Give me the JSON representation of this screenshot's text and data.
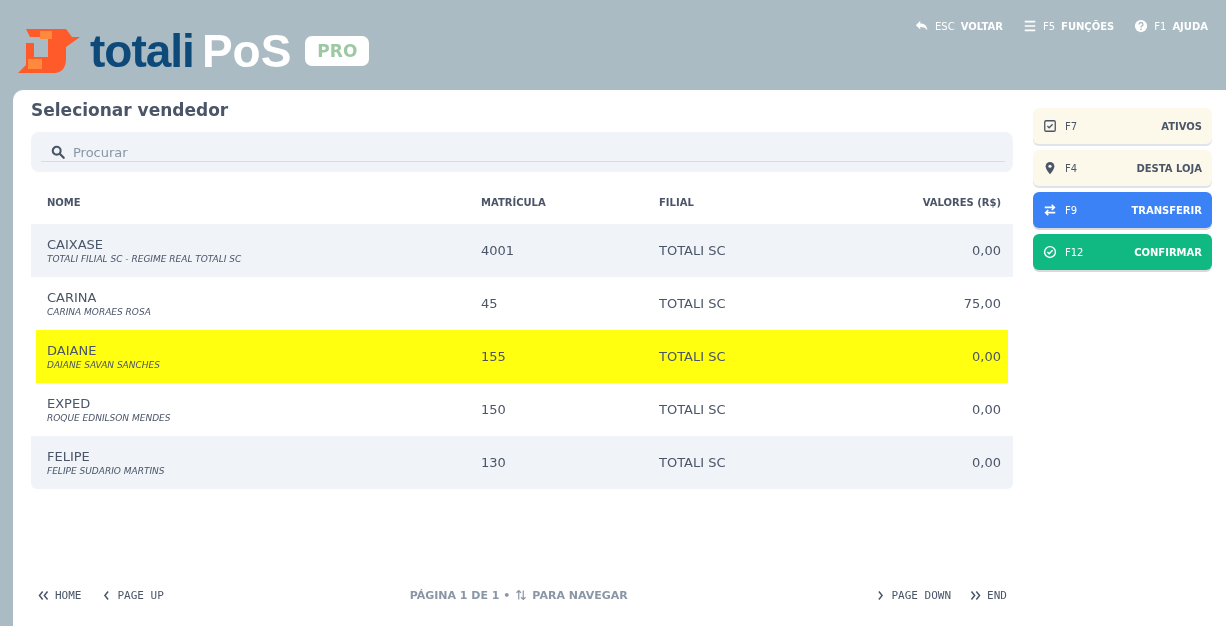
{
  "logo": {
    "brand": "totali",
    "product": "PoS",
    "badge": "PRO"
  },
  "top_actions": [
    {
      "kind": "back",
      "key": "ESC",
      "label": "VOLTAR"
    },
    {
      "kind": "menu",
      "key": "F5",
      "label": "FUNÇÕES"
    },
    {
      "kind": "help",
      "key": "F1",
      "label": "AJUDA"
    }
  ],
  "title": "Selecionar vendedor",
  "search": {
    "placeholder": "Procurar"
  },
  "table": {
    "columns": [
      "NOME",
      "MATRÍCULA",
      "FILIAL",
      "VALORES (R$)"
    ],
    "rows": [
      {
        "name": "CAIXASE",
        "subtitle": "TOTALI FILIAL SC - REGIME REAL TOTALI SC",
        "matricula": "4001",
        "filial": "TOTALI SC",
        "valor": "0,00",
        "selected": false
      },
      {
        "name": "CARINA",
        "subtitle": "CARINA MORAES ROSA",
        "matricula": "45",
        "filial": "TOTALI SC",
        "valor": "75,00",
        "selected": false
      },
      {
        "name": "DAIANE",
        "subtitle": "DAIANE SAVAN SANCHES",
        "matricula": "155",
        "filial": "TOTALI SC",
        "valor": "0,00",
        "selected": true
      },
      {
        "name": "EXPED",
        "subtitle": "ROQUE EDNILSON MENDES",
        "matricula": "150",
        "filial": "TOTALI SC",
        "valor": "0,00",
        "selected": false
      },
      {
        "name": "FELIPE",
        "subtitle": "FELIPE SUDARIO MARTINS",
        "matricula": "130",
        "filial": "TOTALI SC",
        "valor": "0,00",
        "selected": false
      }
    ]
  },
  "side_buttons": [
    {
      "kind": "check",
      "key": "F7",
      "label": "ATIVOS",
      "color": "#fdf9ea"
    },
    {
      "kind": "pin",
      "key": "F4",
      "label": "DESTA LOJA",
      "color": "#fdf9ea"
    },
    {
      "kind": "transfer",
      "key": "F9",
      "label": "TRANSFERIR",
      "color": "#3b82f6"
    },
    {
      "kind": "confirm",
      "key": "F12",
      "label": "CONFIRMAR",
      "color": "#10b981"
    }
  ],
  "pager": {
    "left": [
      {
        "kind": "first",
        "label": "HOME"
      },
      {
        "kind": "prev",
        "label": "PAGE UP"
      }
    ],
    "status": {
      "word": "PÁGINA",
      "page": "1",
      "of": "DE",
      "total": "1",
      "sep": "•",
      "hint": "PARA NAVEGAR"
    },
    "right": [
      {
        "kind": "next",
        "label": "PAGE DOWN"
      },
      {
        "kind": "last",
        "label": "END"
      }
    ]
  }
}
